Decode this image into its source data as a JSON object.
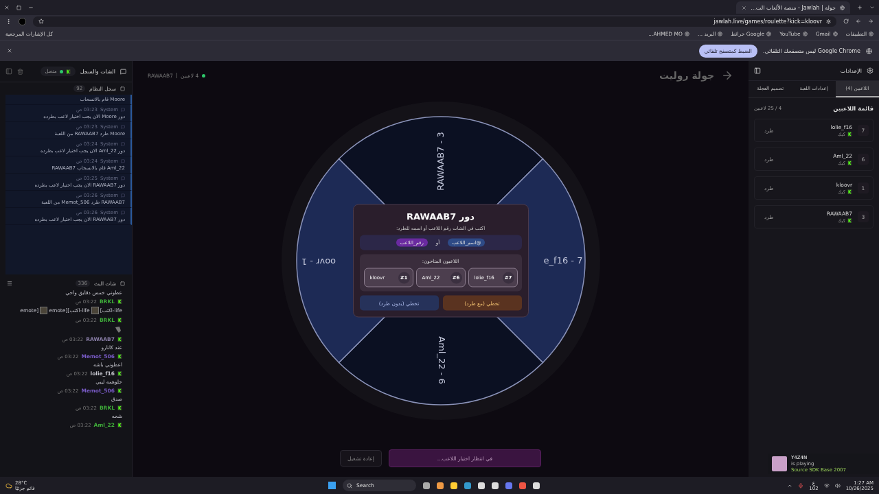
{
  "browser": {
    "tab_title": "جولة | Jawlah - منصة الألعاب الت...",
    "url": "jawlah.live/games/roulette?kick=kloovr",
    "bookmarks": [
      {
        "label": "التطبيقات"
      },
      {
        "label": "Gmail"
      },
      {
        "label": "YouTube"
      },
      {
        "label": "Google خرائط"
      },
      {
        "label": "البريد ..."
      },
      {
        "label": "AHMED MO..."
      }
    ],
    "all_bookmarks": "كل الإشارات المرجعية",
    "infobar": {
      "message": "Google Chrome ليس متصفحك التلقائي.",
      "button": "الضبط كمتصفح تلقائي"
    }
  },
  "chat_panel": {
    "title": "الشات والسجل",
    "status": "متصل",
    "connected": true,
    "system_log": {
      "title": "سجل النظام",
      "count": "92",
      "entries": [
        {
          "text": "Moore قام بالانسحاب"
        },
        {
          "sender": "System",
          "time": "03:23 ص",
          "text": "دور Moore الان يجب اختيار لاعب بطرده"
        },
        {
          "sender": "System",
          "time": "03:23 ص",
          "text": "Moore طرد RAWAAB7 من اللعبة"
        },
        {
          "sender": "System",
          "time": "03:24 ص",
          "text": "دور Aml_22 الان يجب اختيار لاعب بطرده"
        },
        {
          "sender": "System",
          "time": "03:24 ص",
          "text": "Aml_22 قام بالانسحاب RAWAAB7"
        },
        {
          "sender": "System",
          "time": "03:25 ص",
          "text": "دور RAWAAB7 الان يجب اختيار لاعب بطرده"
        },
        {
          "sender": "System",
          "time": "03:26 ص",
          "text": "RAWAAB7 طرد Memot_506 من اللعبة"
        },
        {
          "sender": "System",
          "time": "03:26 ص",
          "text": "دور RAWAAB7 الان يجب اختيار لاعب بطرده"
        }
      ]
    },
    "stream_chat": {
      "title": "شات البث",
      "count": "336",
      "messages": [
        {
          "kind": "text",
          "text": "عطوني خمس دقايق واحي"
        },
        {
          "kind": "emotes",
          "user": "BRKL",
          "color": "#3fae3a",
          "time": "03:22 ص",
          "parts": [
            "life-اكتب]",
            "life-اكتب][emote",
            "[emote"
          ]
        },
        {
          "kind": "sticker",
          "user": "BRKL",
          "color": "#3fae3a",
          "time": "03:22 ص"
        },
        {
          "kind": "text",
          "user": "RAWAAB7",
          "color": "#8a7fa8",
          "time": "03:22 ص",
          "text": "عند كانارو"
        },
        {
          "kind": "text",
          "user": "Memot_506",
          "color": "#7a5cc8",
          "time": "03:22 ص",
          "text": "اعطوني باشه"
        },
        {
          "kind": "text",
          "user": "lolie_f16",
          "color": "#c8c8d0",
          "time": "03:22 ص",
          "text": "خلوهمه ليبي"
        },
        {
          "kind": "text",
          "user": "Memot_506",
          "color": "#7a5cc8",
          "time": "03:22 ص",
          "text": "صدق"
        },
        {
          "kind": "text",
          "user": "BRKL",
          "color": "#3fae3a",
          "time": "03:22 ص",
          "text": "شحه"
        },
        {
          "kind": "text",
          "user": "Aml_22",
          "color": "#3fae3a",
          "time": "03:22 ص"
        }
      ]
    }
  },
  "game": {
    "title": "جولة روليت",
    "turn": "RAWAAB7",
    "players_count": "4 لاعبين",
    "wheel": [
      {
        "label": "RAWAAB7 - 3",
        "kind": "top"
      },
      {
        "label": "e_f16 - 7",
        "kind": "right"
      },
      {
        "label": "Aml_22 - 6",
        "kind": "bottom"
      },
      {
        "label": "oovr - 1",
        "kind": "left"
      }
    ],
    "dialog": {
      "title": "دور RAWAAB7",
      "instruction": "اكتب في الشات رقم اللاعب أو اسمه للطرد:",
      "chips": [
        {
          "kind": "name",
          "text": "@اسم_اللاعب"
        },
        {
          "kind": "or",
          "text": "أو"
        },
        {
          "kind": "number",
          "text": "رقم_اللاعب"
        }
      ],
      "available_title": "اللاعبون المتاحون:",
      "players": [
        {
          "number": "#7",
          "name": "lolie_f16"
        },
        {
          "number": "#6",
          "name": "Aml_22"
        },
        {
          "number": "#1",
          "name": "kloovr"
        }
      ],
      "buttons": [
        {
          "kind": "kick",
          "label": "تخطي (مع طرد)"
        },
        {
          "kind": "skip",
          "label": "تخطي (بدون طرد)"
        }
      ]
    },
    "restart_button": "إعادة تشغيل",
    "waiting": "في انتظار اختيار اللاعب..."
  },
  "settings": {
    "title": "الإعدادات",
    "tabs": [
      {
        "label": "اللاعبين (4)",
        "selected": true
      },
      {
        "label": "إعدادات اللعبة",
        "selected": false
      },
      {
        "label": "تصميم العجلة",
        "selected": false
      }
    ],
    "list_title": "قائمة اللاعبين",
    "capacity": "4 / 25 لاعبين",
    "players": [
      {
        "number": "7",
        "name": "lolie_f16",
        "platform": "كيك",
        "action": "طرد"
      },
      {
        "number": "6",
        "name": "Aml_22",
        "platform": "كيك",
        "action": "طرد"
      },
      {
        "number": "1",
        "name": "kloovr",
        "platform": "كيك",
        "action": "طرد"
      },
      {
        "number": "3",
        "name": "RAWAAB7",
        "platform": "كيك",
        "action": "طرد"
      }
    ]
  },
  "notification": {
    "user": "Y4Z4N",
    "status": "is playing",
    "game": "Source SDK Base 2007"
  },
  "taskbar": {
    "temperature": "28°C",
    "weather": "غائم جزئيًا",
    "search": "Search",
    "language": "ع",
    "lang_sub": "102",
    "time": "1:27 AM",
    "date": "10/26/2025"
  }
}
